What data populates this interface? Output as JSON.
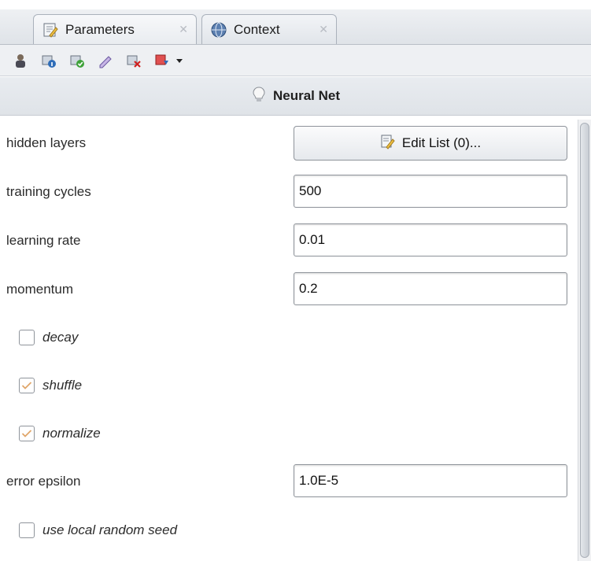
{
  "tabs": [
    {
      "label": "Parameters",
      "icon": "parameters-icon",
      "active": true
    },
    {
      "label": "Context",
      "icon": "globe-icon",
      "active": false
    }
  ],
  "toolbar": {
    "buttons": [
      "expert-mode-icon",
      "info-icon",
      "add-icon",
      "edit-icon",
      "delete-icon",
      "export-icon",
      "dropdown-arrow-icon"
    ]
  },
  "header": {
    "title": "Neural Net",
    "icon": "lightbulb-icon"
  },
  "params": {
    "hidden_layers": {
      "label": "hidden layers",
      "button": "Edit List (0)..."
    },
    "training_cycles": {
      "label": "training cycles",
      "value": "500"
    },
    "learning_rate": {
      "label": "learning rate",
      "value": "0.01"
    },
    "momentum": {
      "label": "momentum",
      "value": "0.2"
    },
    "decay": {
      "label": "decay",
      "checked": false
    },
    "shuffle": {
      "label": "shuffle",
      "checked": true
    },
    "normalize": {
      "label": "normalize",
      "checked": true
    },
    "error_epsilon": {
      "label": "error epsilon",
      "value": "1.0E-5"
    },
    "use_local_random_seed": {
      "label": "use local random seed",
      "checked": false
    }
  },
  "colors": {
    "accent": "#e0a66a",
    "background": "#ffffff",
    "border": "#8e939a"
  }
}
